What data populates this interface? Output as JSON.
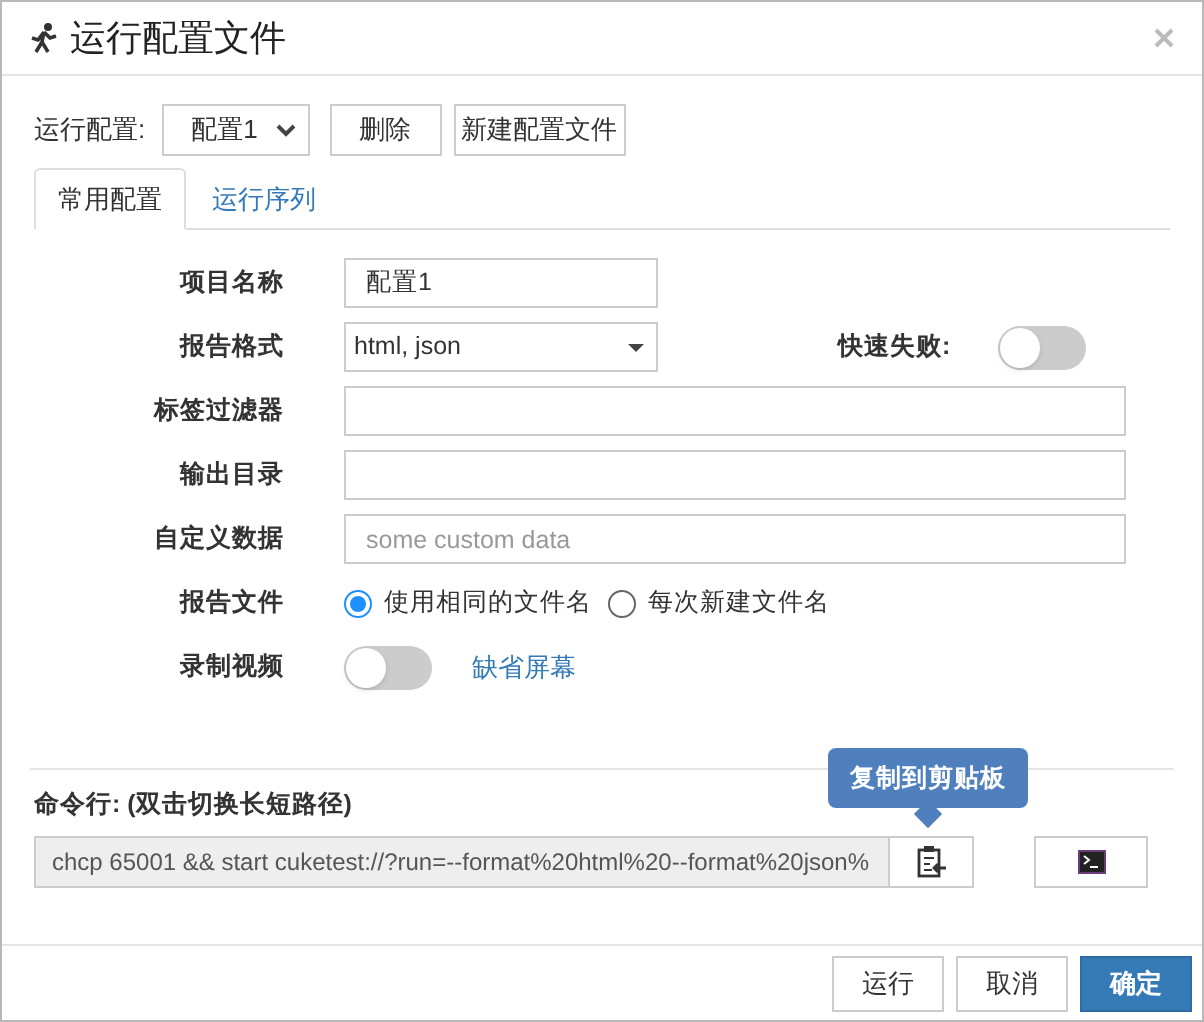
{
  "window": {
    "title": "运行配置文件"
  },
  "config_bar": {
    "label": "运行配置:",
    "select": {
      "value": "配置1"
    },
    "buttons": [
      "删除",
      "新建配置文件"
    ]
  },
  "tabs": [
    {
      "label": "常用配置",
      "selected": true
    },
    {
      "label": "运行序列",
      "selected": false
    }
  ],
  "form": [
    {
      "kind": "text",
      "label": "项目名称",
      "value": "配置1",
      "wide": false
    },
    {
      "kind": "select",
      "label": "报告格式",
      "value": "html, json",
      "toggle": {
        "label": "快速失败:",
        "on": false
      }
    },
    {
      "kind": "text",
      "label": "标签过滤器",
      "wide": true
    },
    {
      "kind": "text",
      "label": "输出目录",
      "wide": true
    },
    {
      "kind": "text",
      "label": "自定义数据",
      "placeholder": "some custom data",
      "wide": true
    },
    {
      "kind": "radio",
      "label": "报告文件",
      "options": [
        {
          "label": "使用相同的文件名",
          "selected": true
        },
        {
          "label": "每次新建文件名",
          "selected": false
        }
      ]
    },
    {
      "kind": "toggle",
      "label": "录制视频",
      "on": false,
      "link": "缺省屏幕"
    }
  ],
  "command": {
    "label": "命令行: (双击切换长短路径)",
    "value": "chcp 65001 && start cuketest://?run=--format%20html%20--format%20json%",
    "tooltip": "复制到剪贴板"
  },
  "footer": [
    {
      "label": "运行",
      "kind": "default"
    },
    {
      "label": "取消",
      "kind": "default"
    },
    {
      "label": "确定",
      "kind": "primary"
    }
  ]
}
